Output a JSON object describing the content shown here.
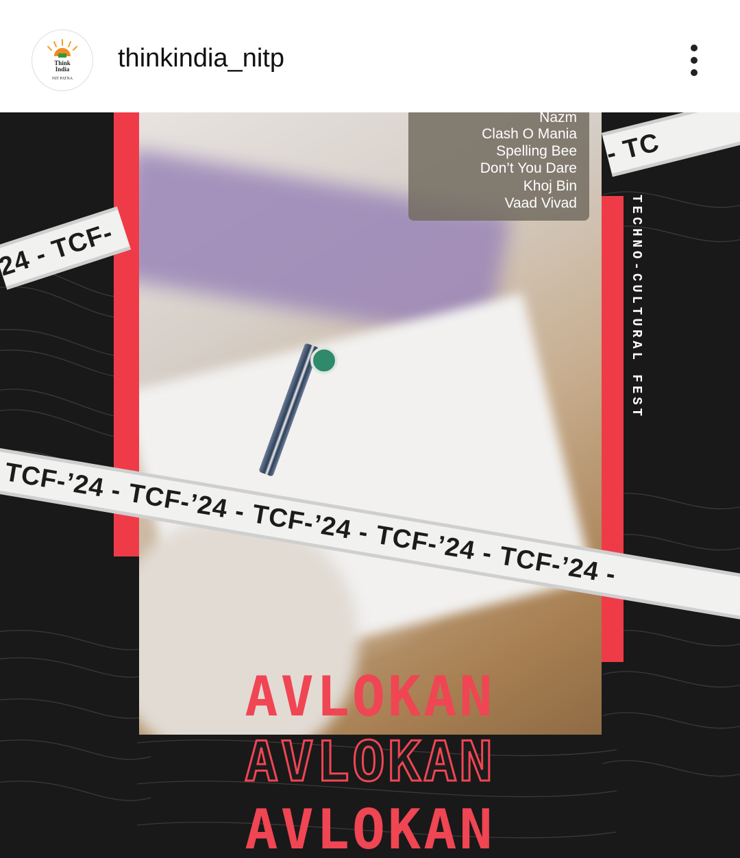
{
  "header": {
    "username": "thinkindia_nitp",
    "avatar_line1": "Think",
    "avatar_line2": "India",
    "avatar_line3": "NIT PATNA",
    "more_icon": "more-vertical-icon"
  },
  "post": {
    "events": [
      "Nazm",
      "Clash O Mania",
      "Spelling Bee",
      "Don’t You Dare",
      "Khoj Bin",
      "Vaad Vivad"
    ],
    "tape_top_left": "24 - TCF-",
    "tape_top_right": "- TC",
    "tape_main": "- TCF-’24 - TCF-’24 - TCF-’24 - TCF-’24 - TCF-’24 -",
    "vertical_text": "TECHNO-CULTURAL FEST",
    "title_repeats": [
      "AVLOKAN",
      "AVLOKAN",
      "AVLOKAN"
    ],
    "accent_color": "#ef3b48",
    "background_color": "#191919"
  }
}
